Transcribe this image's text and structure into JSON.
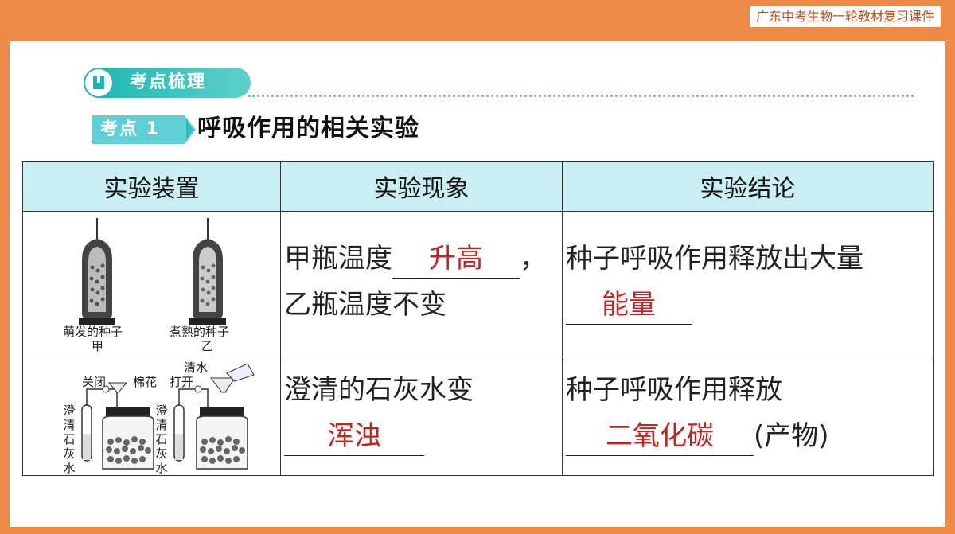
{
  "header": {
    "series_tag": "广东中考生物一轮教材复习课件"
  },
  "section": {
    "label": "考点梳理",
    "icon": "book-icon"
  },
  "key_point": {
    "badge": "考点 1",
    "title": "呼吸作用的相关实验"
  },
  "table": {
    "headers": [
      "实验装置",
      "实验现象",
      "实验结论"
    ],
    "row1": {
      "apparatus": {
        "left_label": "萌发的种子",
        "left_sub": "甲",
        "right_label": "煮熟的种子",
        "right_sub": "乙"
      },
      "phenomenon": {
        "line1_prefix": "甲瓶温度",
        "answer": "升高",
        "line1_suffix": "，",
        "line2": "乙瓶温度不变"
      },
      "conclusion": {
        "line1": "种子呼吸作用释放出大量",
        "answer": "能量"
      }
    },
    "row2": {
      "apparatus": {
        "left_top_a": "关闭",
        "left_top_b": "棉花",
        "right_top_a": "打开",
        "right_top_b": "清水",
        "side_label": [
          "澄",
          "清",
          "石",
          "灰",
          "水"
        ]
      },
      "phenomenon": {
        "line1": "澄清的石灰水变",
        "answer": "浑浊"
      },
      "conclusion": {
        "line1": "种子呼吸作用释放",
        "answer": "二氧化碳",
        "suffix": "(产物)"
      }
    }
  },
  "colors": {
    "frame": "#ee8a45",
    "accent_teal": "#1ab6b0",
    "header_fill": "#c9eef4",
    "answer_red": "#c8241d"
  }
}
